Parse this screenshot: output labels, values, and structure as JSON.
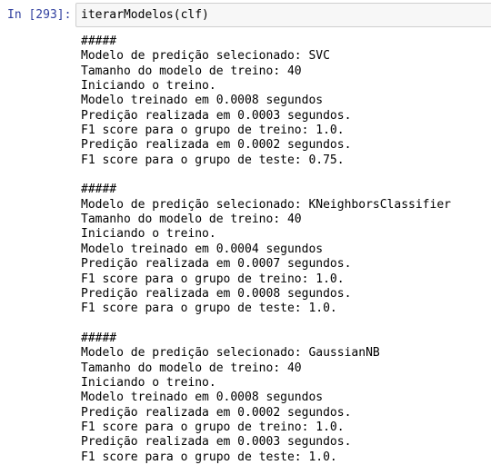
{
  "cell": {
    "prompt": "In [293]:",
    "code": "iterarModelos(clf)",
    "output_lines": [
      "#####",
      "Modelo de predição selecionado: SVC",
      "Tamanho do modelo de treino: 40",
      "Iniciando o treino.",
      "Modelo treinado em 0.0008 segundos",
      "Predição realizada em 0.0003 segundos.",
      "F1 score para o grupo de treino: 1.0.",
      "Predição realizada em 0.0002 segundos.",
      "F1 score para o grupo de teste: 0.75.",
      "",
      "#####",
      "Modelo de predição selecionado: KNeighborsClassifier",
      "Tamanho do modelo de treino: 40",
      "Iniciando o treino.",
      "Modelo treinado em 0.0004 segundos",
      "Predição realizada em 0.0007 segundos.",
      "F1 score para o grupo de treino: 1.0.",
      "Predição realizada em 0.0008 segundos.",
      "F1 score para o grupo de teste: 1.0.",
      "",
      "#####",
      "Modelo de predição selecionado: GaussianNB",
      "Tamanho do modelo de treino: 40",
      "Iniciando o treino.",
      "Modelo treinado em 0.0008 segundos",
      "Predição realizada em 0.0002 segundos.",
      "F1 score para o grupo de treino: 1.0.",
      "Predição realizada em 0.0003 segundos.",
      "F1 score para o grupo de teste: 1.0."
    ]
  },
  "colors": {
    "prompt": "#303f9f",
    "input_background": "#f7f7f7",
    "input_border": "#cfcfcf",
    "text": "#000000"
  }
}
